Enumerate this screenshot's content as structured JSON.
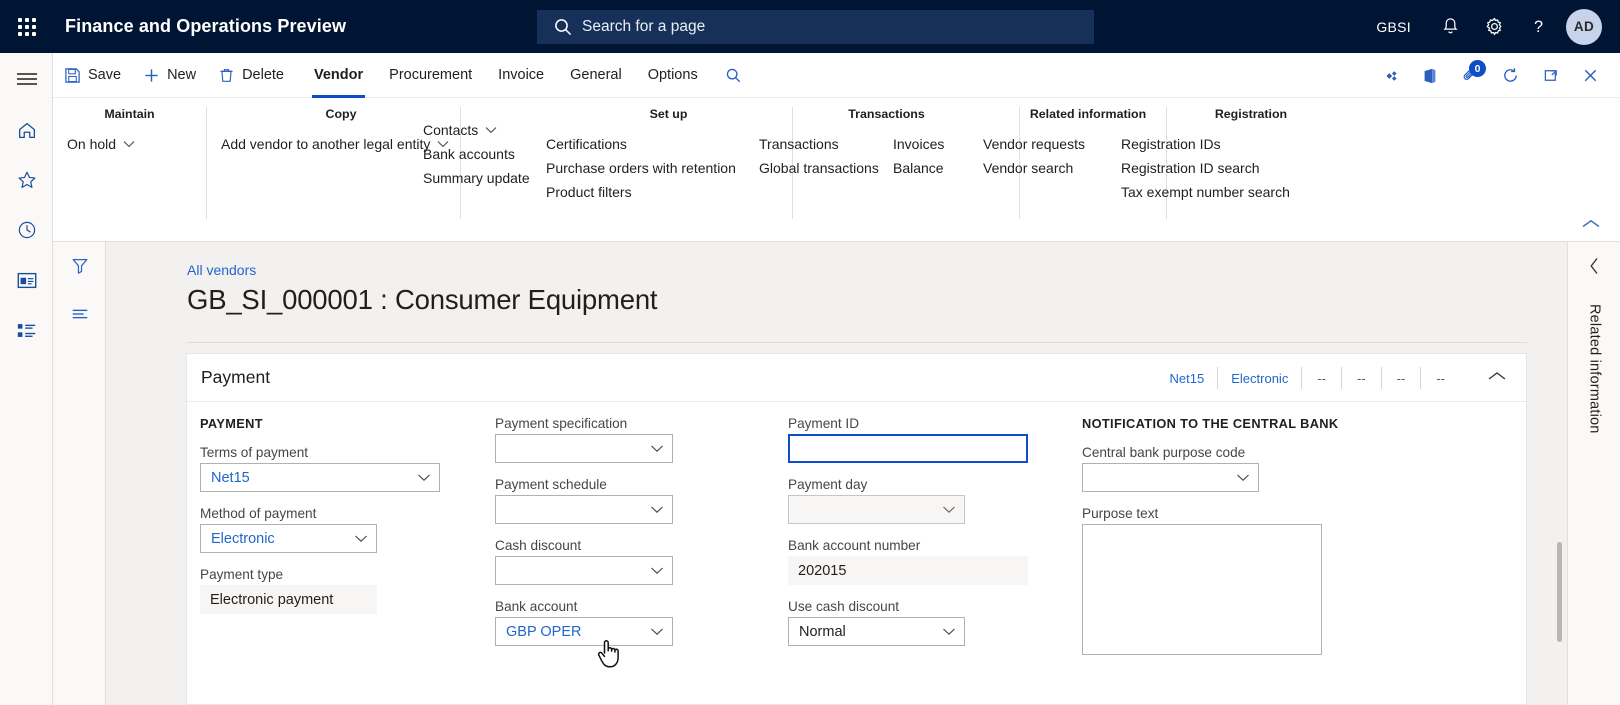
{
  "topbar": {
    "waffle_icon": "waffle-grid-icon",
    "app_title": "Finance and Operations Preview",
    "search": {
      "icon": "search-icon",
      "placeholder": "Search for a page"
    },
    "company": "GBSI",
    "notification_icon": "bell-icon",
    "settings_icon": "gear-icon",
    "help_icon": "question-mark-icon",
    "avatar_initials": "AD"
  },
  "leftrail": {
    "items": [
      {
        "icon": "hamburger-menu-icon",
        "name": "expand-navigation"
      },
      {
        "icon": "home-icon",
        "name": "home"
      },
      {
        "icon": "star-icon",
        "name": "favorites"
      },
      {
        "icon": "clock-icon",
        "name": "recent"
      },
      {
        "icon": "workspace-icon",
        "name": "workspaces"
      },
      {
        "icon": "modules-list-icon",
        "name": "modules"
      }
    ]
  },
  "commandbar": {
    "save_label": "Save",
    "save_icon": "save-disk-icon",
    "new_label": "New",
    "new_icon": "plus-icon",
    "delete_label": "Delete",
    "delete_icon": "trash-icon",
    "tabs": [
      {
        "label": "Vendor",
        "active": true
      },
      {
        "label": "Procurement",
        "active": false
      },
      {
        "label": "Invoice",
        "active": false
      },
      {
        "label": "General",
        "active": false
      },
      {
        "label": "Options",
        "active": false
      }
    ],
    "search_icon": "search-icon",
    "right_icons": [
      {
        "icon": "share-power-apps-icon",
        "name": "power-apps"
      },
      {
        "icon": "office-app-icon",
        "name": "open-in-office"
      },
      {
        "icon": "attachment-icon",
        "name": "attachments",
        "badge": "0"
      },
      {
        "icon": "refresh-icon",
        "name": "refresh"
      },
      {
        "icon": "open-new-window-icon",
        "name": "open-in-new-window"
      },
      {
        "icon": "close-icon",
        "name": "close"
      }
    ]
  },
  "ribbon": {
    "collapse_icon": "chevron-up-icon",
    "groups": [
      {
        "title": "Maintain",
        "columns": [
          [
            {
              "label": "On hold",
              "caret": true
            }
          ]
        ]
      },
      {
        "title": "Copy",
        "columns": [
          [
            {
              "label": "Add vendor to another legal entity",
              "caret": true
            }
          ]
        ]
      },
      {
        "title": "",
        "columns": [
          [
            {
              "label": "Contacts",
              "caret": true
            },
            {
              "label": "Bank accounts",
              "caret": false
            },
            {
              "label": "Summary update",
              "caret": false
            }
          ]
        ]
      },
      {
        "title": "Set up",
        "columns": [
          [
            {
              "label": "Certifications",
              "caret": false
            },
            {
              "label": "Purchase orders with retention",
              "caret": false
            },
            {
              "label": "Product filters",
              "caret": false
            }
          ]
        ]
      },
      {
        "title": "Transactions",
        "columns": [
          [
            {
              "label": "Transactions",
              "caret": false
            },
            {
              "label": "Global transactions",
              "caret": false
            }
          ],
          [
            {
              "label": "Invoices",
              "caret": false
            },
            {
              "label": "Balance",
              "caret": false
            }
          ]
        ]
      },
      {
        "title": "Related information",
        "columns": [
          [
            {
              "label": "Vendor requests",
              "caret": false
            },
            {
              "label": "Vendor search",
              "caret": false
            }
          ]
        ]
      },
      {
        "title": "Registration",
        "columns": [
          [
            {
              "label": "Registration IDs",
              "caret": false
            },
            {
              "label": "Registration ID search",
              "caret": false
            },
            {
              "label": "Tax exempt number search",
              "caret": false
            }
          ]
        ]
      }
    ]
  },
  "sidetools": {
    "filter_icon": "filter-funnel-icon",
    "list_icon": "show-list-icon"
  },
  "page": {
    "breadcrumb": "All vendors",
    "title": "GB_SI_000001 : Consumer Equipment"
  },
  "payment_tab": {
    "header": "Payment",
    "summaries": [
      {
        "text": "Net15",
        "muted": false
      },
      {
        "text": "Electronic",
        "muted": false
      },
      {
        "text": "--",
        "muted": true
      },
      {
        "text": "--",
        "muted": true
      },
      {
        "text": "--",
        "muted": true
      },
      {
        "text": "--",
        "muted": true
      }
    ],
    "collapse_icon": "chevron-up-icon",
    "column1": {
      "section_header": "PAYMENT",
      "fields": [
        {
          "label": "Terms of payment",
          "value": "Net15",
          "type": "combobox",
          "state": "normal"
        },
        {
          "label": "Method of payment",
          "value": "Electronic",
          "type": "combobox",
          "state": "normal"
        },
        {
          "label": "Payment type",
          "value": "Electronic payment",
          "type": "readonly",
          "state": "readonly"
        }
      ]
    },
    "column2": {
      "fields": [
        {
          "label": "Payment specification",
          "value": "",
          "type": "combobox",
          "state": "normal"
        },
        {
          "label": "Payment schedule",
          "value": "",
          "type": "combobox",
          "state": "normal"
        },
        {
          "label": "Cash discount",
          "value": "",
          "type": "combobox",
          "state": "normal"
        },
        {
          "label": "Bank account",
          "value": "GBP OPER",
          "type": "combobox",
          "state": "hover"
        }
      ]
    },
    "column3": {
      "fields": [
        {
          "label": "Payment ID",
          "value": "",
          "type": "text",
          "state": "focused"
        },
        {
          "label": "Payment day",
          "value": "",
          "type": "combobox",
          "state": "dim"
        },
        {
          "label": "Bank account number",
          "value": "202015",
          "type": "readonly",
          "state": "readonly"
        },
        {
          "label": "Use cash discount",
          "value": "Normal",
          "type": "combobox",
          "state": "normal"
        }
      ]
    },
    "column4": {
      "section_header": "NOTIFICATION TO THE CENTRAL BANK",
      "fields": [
        {
          "label": "Central bank purpose code",
          "value": "",
          "type": "combobox",
          "state": "normal"
        },
        {
          "label": "Purpose text",
          "value": "",
          "type": "textarea",
          "state": "normal"
        }
      ]
    }
  },
  "rightpanel": {
    "collapse_icon": "chevron-left-icon",
    "label": "Related information"
  },
  "colors": {
    "nav_bg": "#001433",
    "accent": "#0f4ec9",
    "link": "#2266cc",
    "page_bg": "#f2f1f0",
    "card_bg": "#ffffff"
  },
  "cursor": {
    "icon": "pointing-hand-cursor"
  }
}
